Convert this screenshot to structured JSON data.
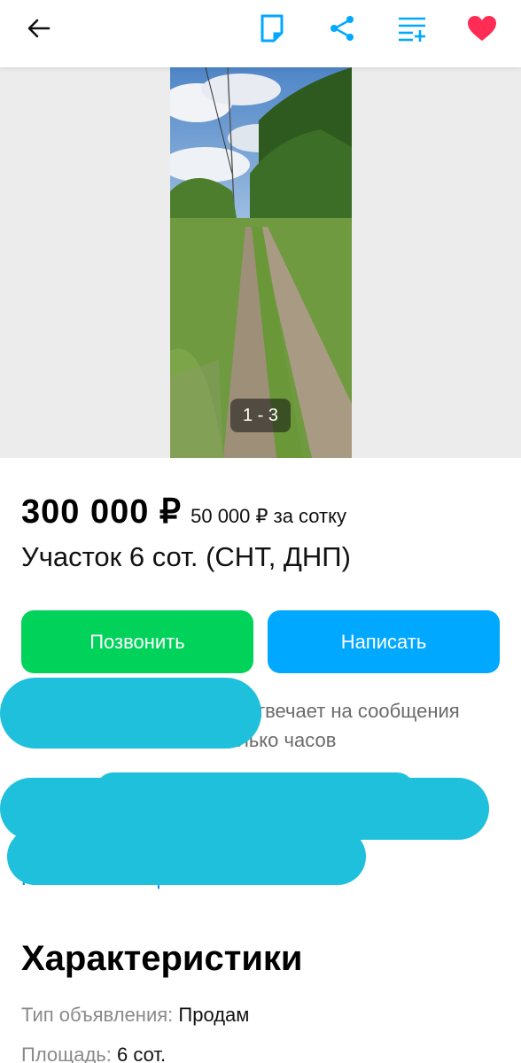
{
  "colors": {
    "accent_blue": "#00a8ff",
    "call_green": "#00d25a",
    "favorite_red": "#ff2d55",
    "scribble": "#1ec0dc",
    "link_blue": "#0a8cf0"
  },
  "header": {
    "icons": [
      "back-arrow-icon",
      "note-icon",
      "share-icon",
      "compare-icon",
      "heart-icon"
    ]
  },
  "gallery": {
    "counter": "1 - 3"
  },
  "listing": {
    "price": "300 000 ₽",
    "price_per": "50 000 ₽ за сотку",
    "title": "Участок 6 сот. (СНТ, ДНП)"
  },
  "actions": {
    "call_label": "Позвонить",
    "write_label": "Написать"
  },
  "seller": {
    "reply_line1": "твечает на сообщения",
    "reply_line2": "лько часов"
  },
  "location": {
    "map_link": "Показать на карте"
  },
  "characteristics": {
    "title": "Характеристики",
    "rows": [
      {
        "key": "Тип объявления: ",
        "value": "Продам"
      },
      {
        "key": "Площадь: ",
        "value": "6 сот."
      }
    ]
  }
}
